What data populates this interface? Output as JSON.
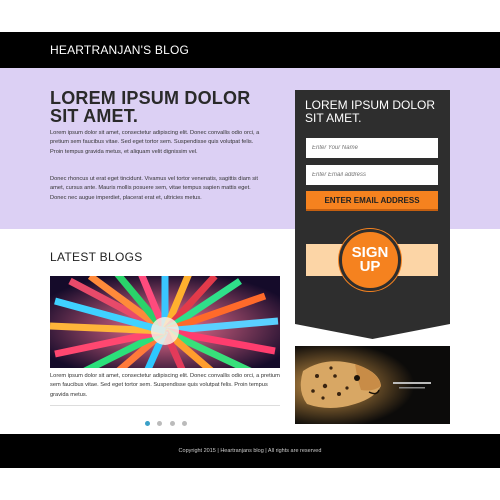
{
  "header": {
    "brand": "HEARTRANJAN'S BLOG"
  },
  "hero": {
    "title": "LOREM IPSUM DOLOR SIT AMET.",
    "paragraph1": "Lorem ipsum dolor sit amet, consectetur adipiscing elit. Donec convallis odio orci, a pretium sem faucibus vitae. Sed eget tortor sem. Suspendisse quis volutpat felis. Proin tempus gravida metus, et aliquam velit dignissim vel.",
    "paragraph2": "Donec rhoncus ut erat eget tincidunt. Vivamus vel tortor venenatis, sagittis diam sit amet, cursus ante. Mauris mollis posuere sem, vitae tempus sapien mattis eget. Donec nec augue imperdiet, placerat erat et, ultricies metus."
  },
  "signup_panel": {
    "title": "LOREM IPSUM DOLOR SIT AMET.",
    "name_placeholder": "Enter Your Name",
    "email_placeholder": "Enter Email address",
    "cta_label": "ENTER EMAIL ADDRESS",
    "badge_line1": "SIGN",
    "badge_line2": "UP",
    "accent_color": "#f5821f"
  },
  "latest": {
    "title": "LATEST BLOGS",
    "post_text": "Lorem ipsum dolor sit amet, consectetur adipiscing elit. Donec convallis odio orci, a pretium sem faucibus vitae. Sed eget tortor sem. Suspendisse quis volutpat felis. Proin tempus gravida metus.",
    "slider_dots": 4,
    "active_dot": 1
  },
  "footer": {
    "copyright": "Copyright 2015 | Heartranjans blog | All rights are reserved"
  }
}
